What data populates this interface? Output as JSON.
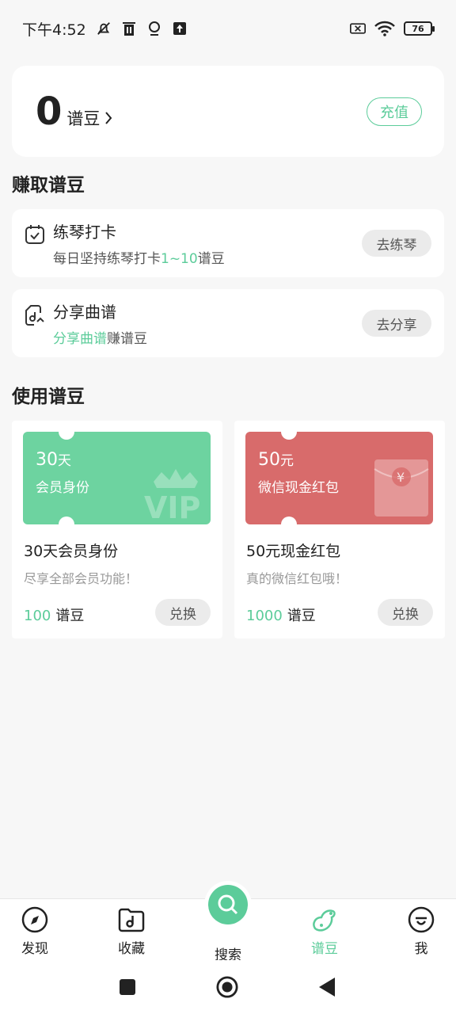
{
  "status_bar": {
    "time": "下午4:52",
    "battery": "76"
  },
  "balance": {
    "value": "0",
    "unit": "谱豆",
    "recharge_label": "充值"
  },
  "earn_section": {
    "title": "赚取谱豆",
    "tasks": [
      {
        "title": "练琴打卡",
        "desc_prefix": "每日坚持练琴打卡",
        "desc_highlight": "1~10",
        "desc_suffix": "谱豆",
        "button": "去练琴",
        "icon": "calendar-check-icon"
      },
      {
        "title": "分享曲谱",
        "desc_prefix": "",
        "desc_highlight": "分享曲谱",
        "desc_suffix": "赚谱豆",
        "button": "去分享",
        "icon": "share-sheet-icon"
      }
    ]
  },
  "use_section": {
    "title": "使用谱豆",
    "rewards": [
      {
        "ticket_amount": "30",
        "ticket_unit": "天",
        "ticket_label": "会员身份",
        "ticket_color": "#6dd3a0",
        "title": "30天会员身份",
        "desc": "尽享全部会员功能！",
        "price": "100",
        "price_unit": "谱豆",
        "button": "兑换"
      },
      {
        "ticket_amount": "50",
        "ticket_unit": "元",
        "ticket_label": "微信现金红包",
        "ticket_color": "#d86b6b",
        "title": "50元现金红包",
        "desc": "真的微信红包哦！",
        "price": "1000",
        "price_unit": "谱豆",
        "button": "兑换"
      }
    ]
  },
  "bottom_nav": {
    "items": [
      {
        "label": "发现",
        "icon": "compass-icon"
      },
      {
        "label": "收藏",
        "icon": "music-folder-icon"
      },
      {
        "label": "搜索",
        "icon": "search-icon"
      },
      {
        "label": "谱豆",
        "icon": "bean-icon",
        "active": true
      },
      {
        "label": "我",
        "icon": "profile-icon"
      }
    ]
  },
  "colors": {
    "accent": "#5ccc9a",
    "red": "#d86b6b"
  }
}
